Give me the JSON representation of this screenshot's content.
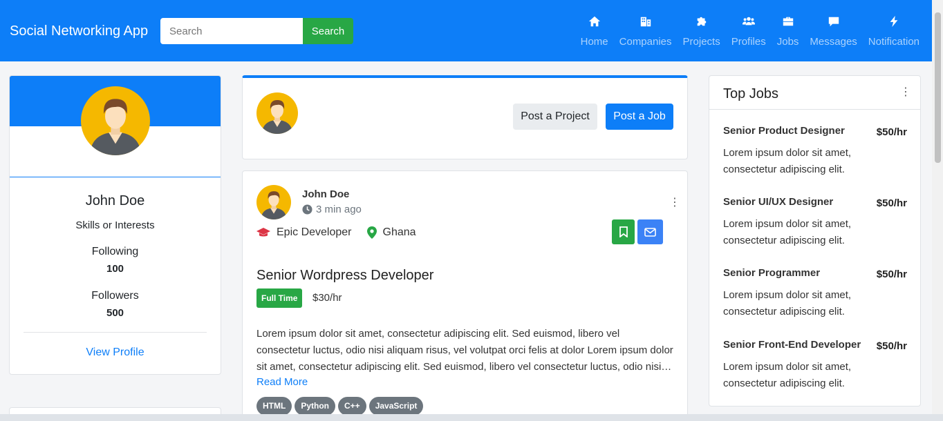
{
  "navbar": {
    "brand": "Social Networking App",
    "search_placeholder": "Search",
    "search_button": "Search",
    "items": [
      {
        "label": "Home",
        "icon": "home-icon"
      },
      {
        "label": "Companies",
        "icon": "building-icon"
      },
      {
        "label": "Projects",
        "icon": "puzzle-icon"
      },
      {
        "label": "Profiles",
        "icon": "users-icon"
      },
      {
        "label": "Jobs",
        "icon": "briefcase-icon"
      },
      {
        "label": "Messages",
        "icon": "message-icon"
      },
      {
        "label": "Notification",
        "icon": "bolt-icon"
      }
    ]
  },
  "profile": {
    "name": "John Doe",
    "subtitle": "Skills or Interests",
    "following_label": "Following",
    "following_value": "100",
    "followers_label": "Followers",
    "followers_value": "500",
    "view_profile": "View Profile"
  },
  "composer": {
    "post_project": "Post a Project",
    "post_job": "Post a Job"
  },
  "feed": {
    "user": "John Doe",
    "time": "3 min ago",
    "role": "Epic Developer",
    "location": "Ghana",
    "job_title": "Senior Wordpress Developer",
    "badge": "Full Time",
    "rate": "$30/hr",
    "description": "Lorem ipsum dolor sit amet, consectetur adipiscing elit. Sed euismod, libero vel consectetur luctus, odio nisi aliquam risus, vel volutpat orci felis at dolor Lorem ipsum dolor sit amet, consectetur adipiscing elit. Sed euismod, libero vel consectetur luctus, odio nisi aliquam risus",
    "read_more": "Read More",
    "tags": [
      "HTML",
      "Python",
      "C++",
      "JavaScript"
    ]
  },
  "top_jobs": {
    "title": "Top Jobs",
    "items": [
      {
        "title": "Senior Product Designer",
        "rate": "$50/hr",
        "desc": "Lorem ipsum dolor sit amet, consectetur adipiscing elit."
      },
      {
        "title": "Senior UI/UX Designer",
        "rate": "$50/hr",
        "desc": "Lorem ipsum dolor sit amet, consectetur adipiscing elit."
      },
      {
        "title": "Senior Programmer",
        "rate": "$50/hr",
        "desc": "Lorem ipsum dolor sit amet, consectetur adipiscing elit."
      },
      {
        "title": "Senior Front-End Developer",
        "rate": "$50/hr",
        "desc": "Lorem ipsum dolor sit amet, consectetur adipiscing elit."
      }
    ]
  },
  "colors": {
    "primary": "#0d7ef8",
    "success": "#28a745",
    "secondary": "#6c757d",
    "avatar_bg": "#f5b800"
  }
}
